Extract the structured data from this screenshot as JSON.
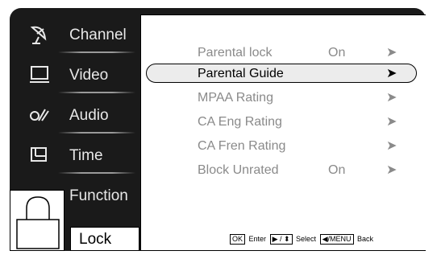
{
  "sidebar": {
    "items": [
      {
        "label": "Channel",
        "icon": "satellite-dish-icon"
      },
      {
        "label": "Video",
        "icon": "monitor-icon"
      },
      {
        "label": "Audio",
        "icon": "audio-icon"
      },
      {
        "label": "Time",
        "icon": "clock-window-icon"
      },
      {
        "label": "Function",
        "icon": "tray-icon"
      },
      {
        "label": "Lock",
        "icon": "padlock-icon"
      }
    ],
    "active": "Lock"
  },
  "menu": {
    "rows": [
      {
        "name": "Parental lock",
        "value": "On",
        "arrow": "➤"
      },
      {
        "name": "Parental Guide",
        "value": "",
        "arrow": "➤",
        "selected": true
      },
      {
        "name": "MPAA Rating",
        "value": "",
        "arrow": "➤"
      },
      {
        "name": "CA Eng Rating",
        "value": "",
        "arrow": "➤"
      },
      {
        "name": "CA Fren Rating",
        "value": "",
        "arrow": "➤"
      },
      {
        "name": "Block Unrated",
        "value": "On",
        "arrow": "➤"
      }
    ]
  },
  "footer": {
    "ok_key": "OK",
    "enter_label": "Enter",
    "nav_key": "▶ / ⬍",
    "select_label": "Select",
    "menu_key": "◀/MENU",
    "back_label": "Back"
  },
  "colors": {
    "bezel": "#1a1a1a",
    "panel": "#ffffff",
    "disabled_text": "#8a8a8a"
  }
}
